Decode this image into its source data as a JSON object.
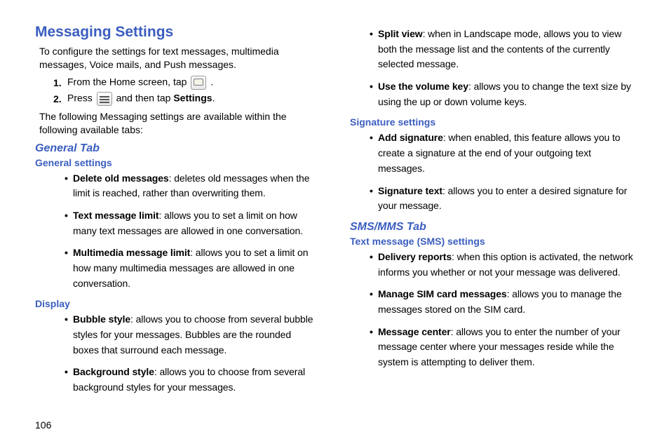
{
  "pageNumber": "106",
  "title": "Messaging Settings",
  "intro": "To configure the settings for text messages, multimedia messages, Voice mails, and Push messages.",
  "step1": {
    "num": "1.",
    "pre": "From the Home screen, tap ",
    "post": " ."
  },
  "step2": {
    "num": "2.",
    "pre": "Press ",
    "mid": " and then tap ",
    "bold": "Settings",
    "post": "."
  },
  "followText": "The following Messaging settings are available within the following available tabs:",
  "generalTab": "General Tab",
  "generalSettings": "General settings",
  "gs": {
    "deleteOld": {
      "b": "Delete old messages",
      "t": ": deletes old messages when the limit is reached, rather than overwriting them."
    },
    "textLimit": {
      "b": "Text message limit",
      "t": ": allows you to set a limit on how many text messages are allowed in one conversation."
    },
    "mmLimit": {
      "b": "Multimedia message limit",
      "t": ": allows you to set a limit on how many multimedia messages are allowed in one conversation."
    }
  },
  "display": "Display",
  "ds": {
    "bubble": {
      "b": "Bubble style",
      "t": ": allows you to choose from several bubble styles for your messages. Bubbles are the rounded boxes that surround each message."
    },
    "bg": {
      "b": "Background style",
      "t": ": allows you to choose from several background styles for your messages."
    },
    "split": {
      "b": "Split view",
      "t": ": when in Landscape mode, allows you to view both the message list and the contents of the currently selected message."
    },
    "vol": {
      "b": "Use the volume key",
      "t": ": allows you to change the text size by using the up or down volume keys."
    }
  },
  "sigSettings": "Signature settings",
  "sig": {
    "add": {
      "b": "Add signature",
      "t": ": when enabled, this feature allows you to create a signature at the end of your outgoing text messages."
    },
    "text": {
      "b": "Signature text",
      "t": ": allows you to enter a desired signature for your message."
    }
  },
  "smsTab": "SMS/MMS Tab",
  "smsSettings": "Text message (SMS) settings",
  "sms": {
    "delivery": {
      "b": "Delivery reports",
      "t": ": when this option is activated, the network informs you whether or not your message was delivered."
    },
    "sim": {
      "b": "Manage SIM card messages",
      "t": ": allows you to manage the messages stored on the SIM card."
    },
    "center": {
      "b": "Message center",
      "t": ": allows you to enter the number of your message center where your messages reside while the system is attempting to deliver them."
    }
  }
}
